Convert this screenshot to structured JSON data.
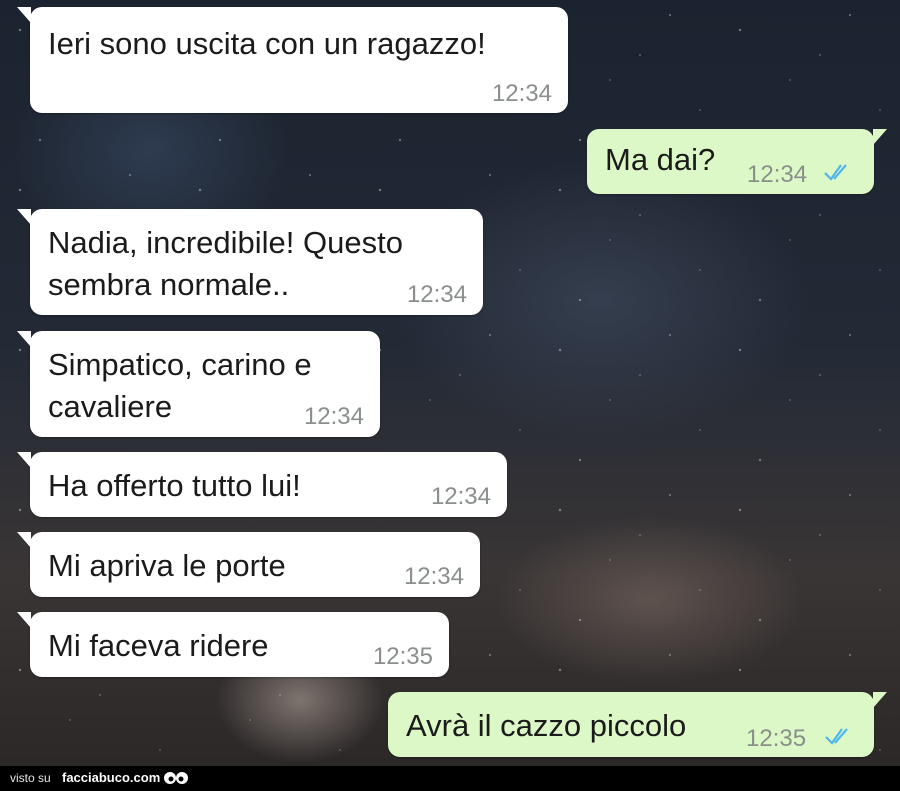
{
  "messages": [
    {
      "direction": "in",
      "text": "Ieri sono uscita con un ragazzo!",
      "time": "12:34"
    },
    {
      "direction": "out",
      "text": "Ma dai?",
      "time": "12:34",
      "status": "read"
    },
    {
      "direction": "in",
      "lines": [
        "Nadia, incredibile! Questo",
        "sembra normale.."
      ],
      "time": "12:34"
    },
    {
      "direction": "in",
      "lines": [
        "Simpatico, carino e",
        "cavaliere"
      ],
      "time": "12:34"
    },
    {
      "direction": "in",
      "text": "Ha offerto tutto lui!",
      "time": "12:34"
    },
    {
      "direction": "in",
      "text": "Mi apriva le porte",
      "time": "12:34"
    },
    {
      "direction": "in",
      "text": "Mi faceva ridere",
      "time": "12:35"
    },
    {
      "direction": "out",
      "text": "Avrà il cazzo piccolo",
      "time": "12:35",
      "status": "read"
    }
  ],
  "footer": {
    "visto_su": "visto su",
    "brand": "facciabuco.com"
  },
  "colors": {
    "incoming": "#ffffff",
    "outgoing": "#dcf8c6",
    "read_ticks": "#4fb6ec",
    "time": "#8a8f8b"
  },
  "icons": {
    "read": "double-check-icon",
    "logo": "eyes-icon"
  }
}
